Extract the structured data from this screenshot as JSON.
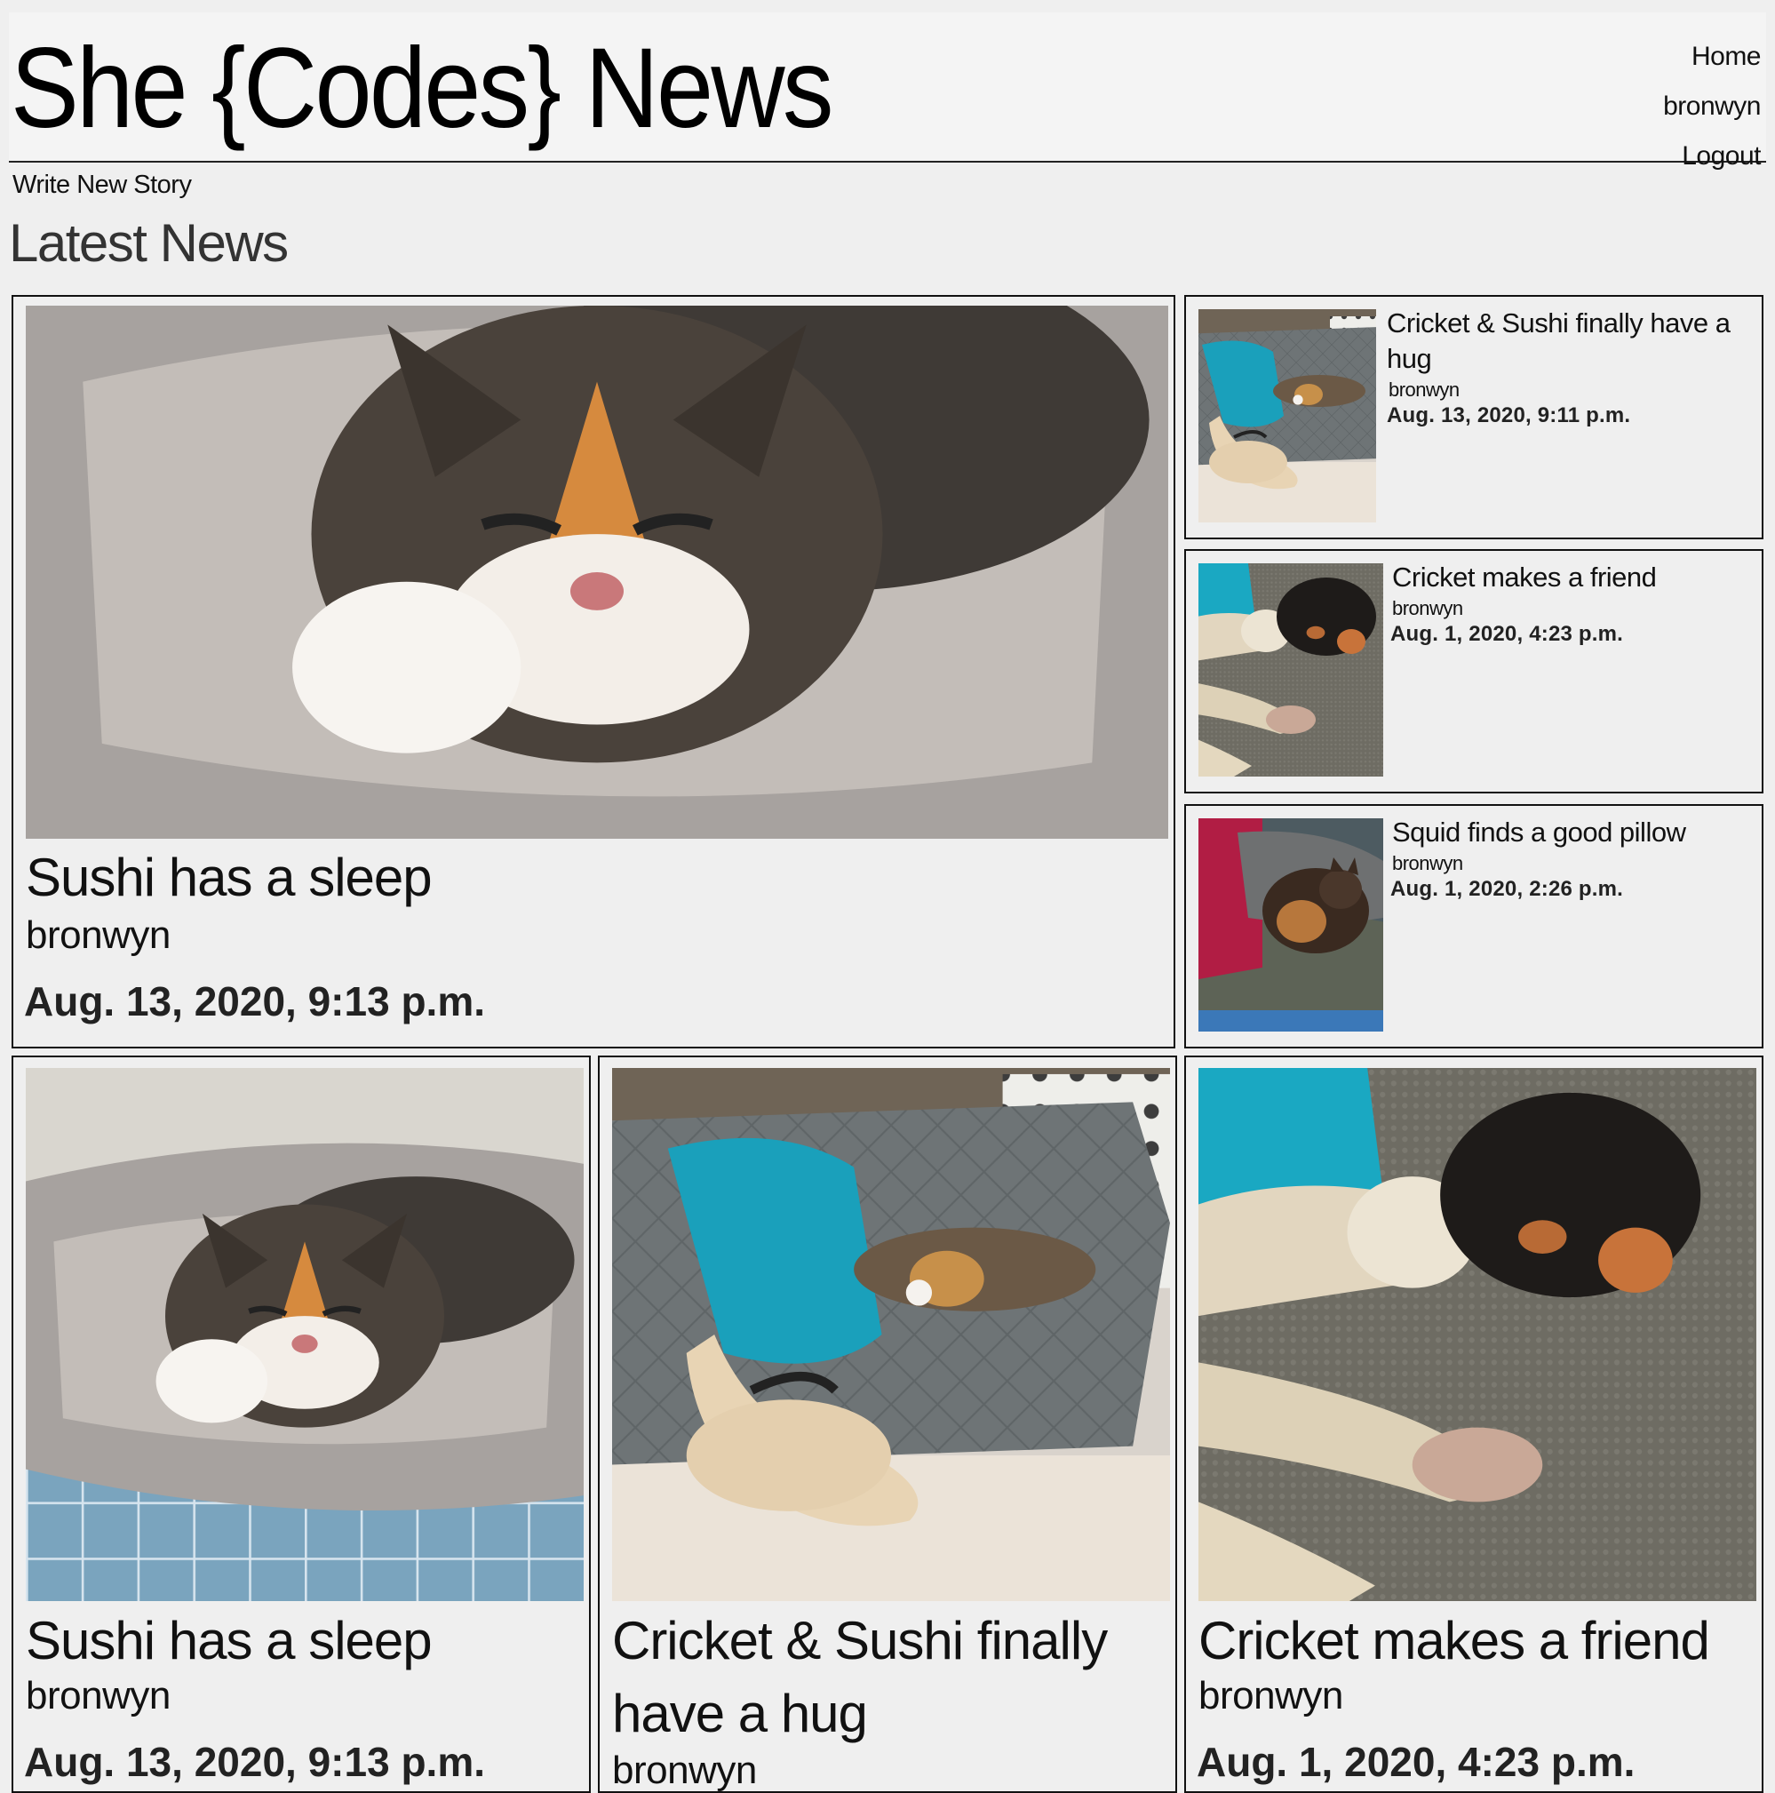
{
  "site": {
    "title": "She {Codes} News"
  },
  "nav": {
    "home": "Home",
    "user": "bronwyn",
    "logout": "Logout"
  },
  "actions": {
    "write_new_story": "Write New Story"
  },
  "section": {
    "heading": "Latest News"
  },
  "featured": {
    "title": "Sushi has a sleep",
    "author": "bronwyn",
    "date": "Aug. 13, 2020, 9:13 p.m.",
    "image": "cat-sleeping-in-bed"
  },
  "side_stories": [
    {
      "title": "Cricket & Sushi finally have a hug",
      "author": "bronwyn",
      "date": "Aug. 13, 2020, 9:11 p.m.",
      "image": "dog-and-cat-hug"
    },
    {
      "title": "Cricket makes a friend",
      "author": "bronwyn",
      "date": "Aug. 1, 2020, 4:23 p.m.",
      "image": "two-dogs-on-couch"
    },
    {
      "title": "Squid finds a good pillow",
      "author": "bronwyn",
      "date": "Aug. 1, 2020, 2:26 p.m.",
      "image": "cat-on-dog"
    }
  ],
  "grid_stories": [
    {
      "title": "Sushi has a sleep",
      "author": "bronwyn",
      "date": "Aug. 13, 2020, 9:13 p.m.",
      "image": "cat-sleeping-in-bed"
    },
    {
      "title": "Cricket & Sushi finally have a hug",
      "author": "bronwyn",
      "date": "",
      "image": "dog-and-cat-hug"
    },
    {
      "title": "Cricket makes a friend",
      "author": "bronwyn",
      "date": "Aug. 1, 2020, 4:23 p.m.",
      "image": "two-dogs-on-couch"
    }
  ]
}
